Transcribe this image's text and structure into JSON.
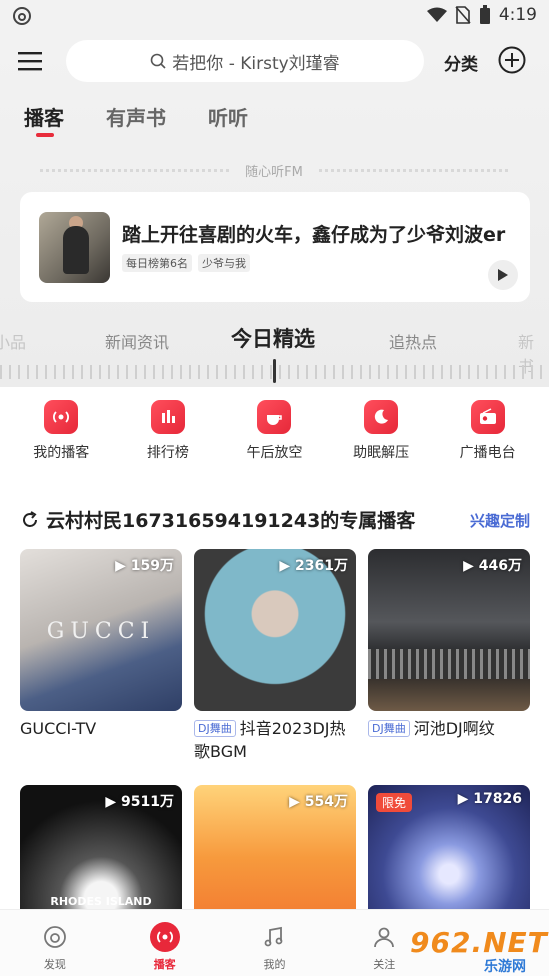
{
  "status_bar": {
    "time": "4:19"
  },
  "header": {
    "search_placeholder": "若把你 - Kirsty刘瑾睿",
    "category_label": "分类",
    "tabs": [
      {
        "label": "播客",
        "active": true
      },
      {
        "label": "有声书",
        "active": false
      },
      {
        "label": "听听",
        "active": false
      }
    ]
  },
  "fm": {
    "section_label": "随心听FM",
    "title": "踏上开往喜剧的火车，鑫仔成为了少爷刘波er",
    "tags": [
      "每日榜第6名",
      "少爷与我"
    ]
  },
  "dial": {
    "items": [
      "小品",
      "新闻资讯",
      "今日精选",
      "追热点",
      "新书"
    ],
    "active": "今日精选"
  },
  "quick_actions": [
    {
      "label": "我的播客",
      "icon": "podcast-icon"
    },
    {
      "label": "排行榜",
      "icon": "chart-bars-icon"
    },
    {
      "label": "午后放空",
      "icon": "coffee-cup-icon"
    },
    {
      "label": "助眠解压",
      "icon": "moon-icon"
    },
    {
      "label": "广播电台",
      "icon": "radio-icon"
    }
  ],
  "recommend": {
    "title": "云村村民167316594191243的专属播客",
    "custom_link": "兴趣定制",
    "cards": [
      {
        "play_count": "159万",
        "tag": "",
        "title": "GUCCI-TV",
        "cover_text": "GUCCI"
      },
      {
        "play_count": "2361万",
        "tag": "DJ舞曲",
        "title": "抖音2023DJ热歌BGM"
      },
      {
        "play_count": "446万",
        "tag": "DJ舞曲",
        "title": "河池DJ啊纹"
      },
      {
        "play_count": "9511万",
        "tag": "",
        "title": "",
        "cover_text": "RHODES ISLAND"
      },
      {
        "play_count": "554万",
        "tag": "",
        "title": ""
      },
      {
        "play_count": "17826",
        "tag": "",
        "title": "",
        "badge": "限免"
      }
    ]
  },
  "bottom_nav": [
    {
      "label": "发现",
      "icon": "netease-logo-icon",
      "active": false
    },
    {
      "label": "播客",
      "icon": "podcast-icon",
      "active": true
    },
    {
      "label": "我的",
      "icon": "music-note-icon",
      "active": false
    },
    {
      "label": "关注",
      "icon": "person-icon",
      "active": false
    }
  ],
  "watermark": {
    "big": "962.NET",
    "small": "乐游网"
  },
  "colors": {
    "brand_red": "#e8283a",
    "link_blue": "#4a6bd4"
  }
}
